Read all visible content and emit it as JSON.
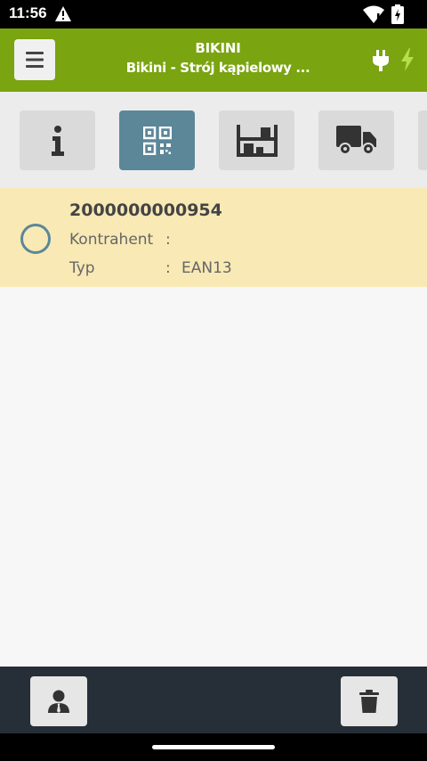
{
  "status_bar": {
    "time": "11:56",
    "icons": [
      "alert-icon",
      "wifi-icon",
      "battery-charging-icon"
    ]
  },
  "header": {
    "title": "BIKINI",
    "subtitle": "Bikini - Strój kąpielowy ...",
    "background": "#7aa410",
    "icons": [
      "menu-icon",
      "plug-icon",
      "bolt-icon"
    ]
  },
  "tabs": [
    {
      "icon": "info-icon",
      "active": false
    },
    {
      "icon": "qr-code-icon",
      "active": true
    },
    {
      "icon": "warehouse-shelf-icon",
      "active": false
    },
    {
      "icon": "truck-icon",
      "active": false
    },
    {
      "icon": "more-tab",
      "active": false
    }
  ],
  "list": {
    "items": [
      {
        "code": "2000000000954",
        "fields": [
          {
            "label": "Kontrahent",
            "separator": ":",
            "value": ""
          },
          {
            "label": "Typ",
            "separator": ":",
            "value": "EAN13"
          }
        ],
        "selected": false,
        "highlight_color": "#f8e9b5"
      }
    ]
  },
  "bottom_bar": {
    "buttons": [
      {
        "icon": "user-icon"
      },
      {
        "icon": "trash-icon"
      }
    ]
  },
  "colors": {
    "accent": "#5b8799",
    "toolbar": "#262f38"
  }
}
